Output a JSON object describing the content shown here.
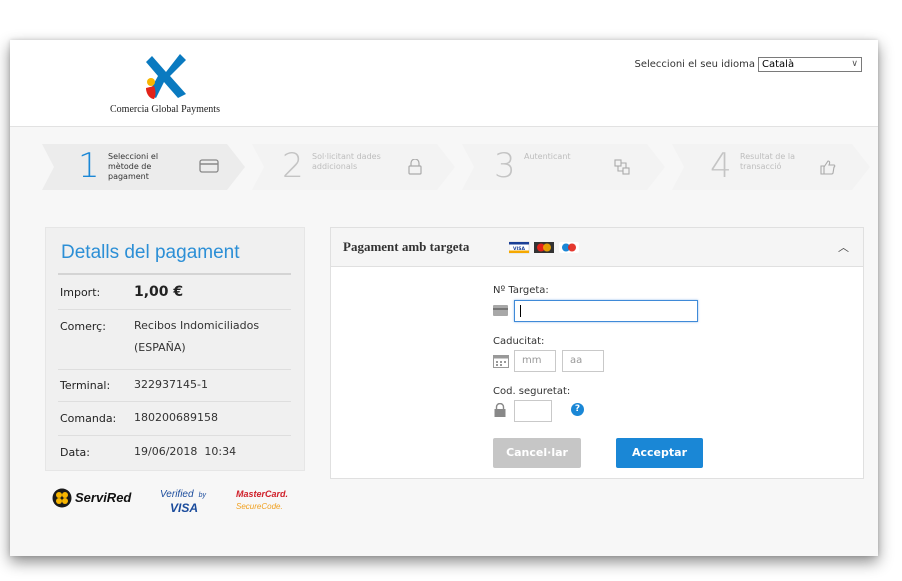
{
  "header": {
    "logo_caption": "Comercia Global Payments",
    "language_label": "Seleccioni el seu idioma",
    "language_selected": "Català"
  },
  "steps": [
    {
      "number": "1",
      "label": "Seleccioni el mètode de pagament",
      "state": "active",
      "icon": "card-icon"
    },
    {
      "number": "2",
      "label": "Sol·licitant dades addicionals",
      "state": "inactive",
      "icon": "lock-icon"
    },
    {
      "number": "3",
      "label": "Autenticant",
      "state": "inactive",
      "icon": "network-icon"
    },
    {
      "number": "4",
      "label": "Resultat de la transacció",
      "state": "inactive",
      "icon": "thumbs-up-icon"
    }
  ],
  "details": {
    "title": "Detalls del pagament",
    "rows": [
      {
        "key": "Import:",
        "value": "1,00 €"
      },
      {
        "key": "Comerç:",
        "value": "Recibos Indomiciliados (ESPAÑA)"
      },
      {
        "key": "Terminal:",
        "value": "322937145-1"
      },
      {
        "key": "Comanda:",
        "value": "180200689158"
      },
      {
        "key": "Data:",
        "value": "19/06/2018  10:34"
      }
    ]
  },
  "brands": {
    "servired": "ServiRed",
    "verified_by": "Verified",
    "verified_by_small": "by",
    "verified_visa": "VISA",
    "mastercard": "MasterCard.",
    "securecode": "SecureCode."
  },
  "payment": {
    "title": "Pagament amb targeta",
    "card_brands": [
      "VISA",
      "MasterCard",
      "Maestro"
    ],
    "card_number_label": "Nº Targeta:",
    "card_number_value": "",
    "expiry_label": "Caducitat:",
    "month_placeholder": "mm",
    "year_placeholder": "aa",
    "cvv_label": "Cod. seguretat:",
    "cvv_help": "?",
    "cancel_label": "Cancel·lar",
    "accept_label": "Acceptar"
  },
  "colors": {
    "accent": "#1a87d6",
    "disabled": "#c6c6c6",
    "logo_blue": "#0a7ac0",
    "logo_yellow": "#f7b500",
    "logo_red": "#e2231a"
  }
}
